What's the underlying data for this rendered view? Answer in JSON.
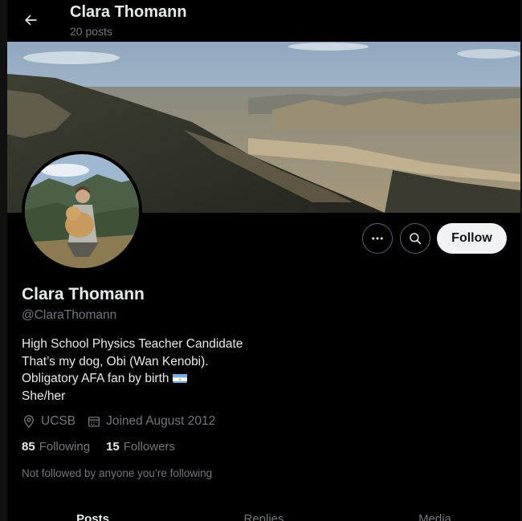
{
  "header": {
    "title": "Clara Thomann",
    "post_count": "20 posts"
  },
  "profile": {
    "name": "Clara Thomann",
    "handle": "@ClaraThomann",
    "bio": [
      "High School Physics Teacher Candidate",
      "That’s my dog, Obi (Wan Kenobi).",
      "Obligatory AFA fan by birth",
      "She/her"
    ],
    "location": "UCSB",
    "joined": "Joined August 2012",
    "following_count": "85",
    "following_label": "Following",
    "followers_count": "15",
    "followers_label": "Followers",
    "not_followed_note": "Not followed by anyone you’re following"
  },
  "actions": {
    "follow_label": "Follow"
  },
  "tabs": [
    {
      "label": "Posts"
    },
    {
      "label": "Replies"
    },
    {
      "label": "Media"
    }
  ],
  "colors": {
    "background": "#000000",
    "text_primary": "#e7e9ea",
    "text_secondary": "#71767b",
    "follow_button_bg": "#eff3f4",
    "border": "#536471"
  }
}
